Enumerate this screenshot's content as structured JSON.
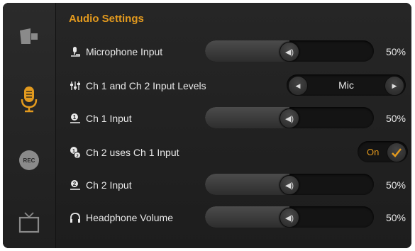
{
  "colors": {
    "accent": "#e39a1e",
    "text": "#e8e8e8",
    "icon_inactive": "#8a8a8a"
  },
  "sidebar": {
    "items": [
      {
        "name": "camera",
        "icon": "camera-icon",
        "active": false
      },
      {
        "name": "audio",
        "icon": "microphone-icon",
        "active": true
      },
      {
        "name": "record",
        "icon": "rec-icon",
        "label": "REC",
        "active": false
      },
      {
        "name": "display",
        "icon": "tv-icon",
        "active": false
      }
    ]
  },
  "page": {
    "title": "Audio Settings"
  },
  "settings": {
    "microphone_input": {
      "label": "Microphone Input",
      "value": "50%",
      "level": 0.5,
      "icon": "microphone-input-icon"
    },
    "input_levels": {
      "label": "Ch 1 and Ch 2 Input Levels",
      "value": "Mic",
      "icon": "mixer-icon"
    },
    "ch1_input": {
      "label": "Ch 1 Input",
      "value": "50%",
      "level": 0.5,
      "icon": "channel-1-icon"
    },
    "ch2_uses_ch1": {
      "label": "Ch 2 uses Ch 1 Input",
      "value": "On",
      "icon": "channel-link-icon"
    },
    "ch2_input": {
      "label": "Ch 2 Input",
      "value": "50%",
      "level": 0.5,
      "icon": "channel-2-icon"
    },
    "headphone_volume": {
      "label": "Headphone Volume",
      "value": "50%",
      "level": 0.5,
      "icon": "headphone-icon"
    }
  }
}
